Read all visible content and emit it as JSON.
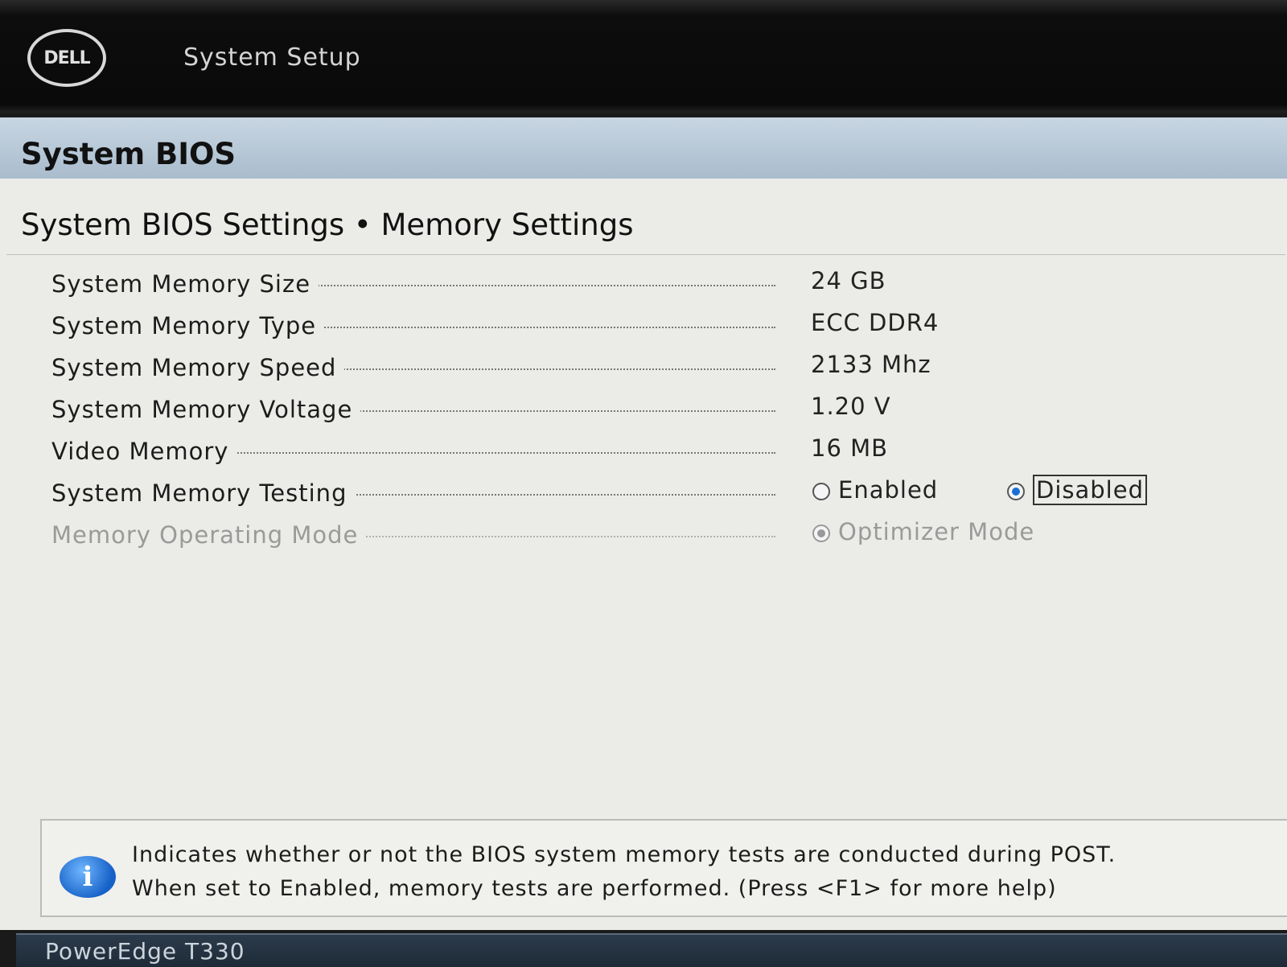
{
  "header": {
    "logo_text": "DELL",
    "app_title": "System Setup"
  },
  "section": {
    "title": "System BIOS",
    "page_title": "System BIOS Settings • Memory Settings"
  },
  "settings": [
    {
      "label": "System Memory Size",
      "value": "24 GB"
    },
    {
      "label": "System Memory Type",
      "value": "ECC DDR4"
    },
    {
      "label": "System Memory Speed",
      "value": "2133 Mhz"
    },
    {
      "label": "System Memory Voltage",
      "value": "1.20 V"
    },
    {
      "label": "Video Memory",
      "value": "16 MB"
    },
    {
      "label": "System Memory Testing",
      "options": [
        "Enabled",
        "Disabled"
      ],
      "selected": "Disabled"
    },
    {
      "label": "Memory Operating Mode",
      "options": [
        "Optimizer Mode"
      ],
      "selected": "Optimizer Mode",
      "disabled": true
    }
  ],
  "help": {
    "line1": "Indicates whether or not the BIOS system memory tests are conducted during POST.",
    "line2": "When set to Enabled, memory tests are performed. (Press <F1> for more help)"
  },
  "footer": {
    "model": "PowerEdge T330"
  },
  "colors": {
    "header_bg": "#0d0d0d",
    "section_bar": "#b4c5d4",
    "panel_bg": "#ebebe8",
    "radio_selected": "#1a6fd6"
  }
}
